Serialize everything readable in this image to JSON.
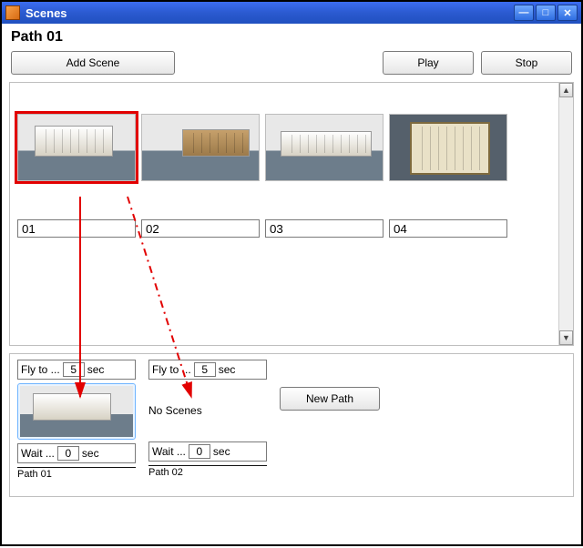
{
  "window": {
    "title": "Scenes"
  },
  "header": {
    "path_title": "Path 01"
  },
  "toolbar": {
    "add_scene_label": "Add Scene",
    "play_label": "Play",
    "stop_label": "Stop"
  },
  "scenes": [
    {
      "name": "01",
      "selected": true
    },
    {
      "name": "02",
      "selected": false
    },
    {
      "name": "03",
      "selected": false
    },
    {
      "name": "04",
      "selected": false
    }
  ],
  "paths_panel": {
    "no_scenes_label": "No Scenes",
    "new_path_label": "New Path",
    "paths": [
      {
        "name": "Path 01",
        "active": true,
        "has_thumb": true,
        "fly_label": "Fly to ...",
        "fly_value": "5",
        "fly_unit": "sec",
        "wait_label": "Wait ...",
        "wait_value": "0",
        "wait_unit": "sec"
      },
      {
        "name": "Path 02",
        "active": false,
        "has_thumb": false,
        "fly_label": "Fly to ...",
        "fly_value": "5",
        "fly_unit": "sec",
        "wait_label": "Wait ...",
        "wait_value": "0",
        "wait_unit": "sec"
      }
    ]
  },
  "colors": {
    "selection_red": "#e20000",
    "titlebar_blue": "#2b5ad0"
  }
}
